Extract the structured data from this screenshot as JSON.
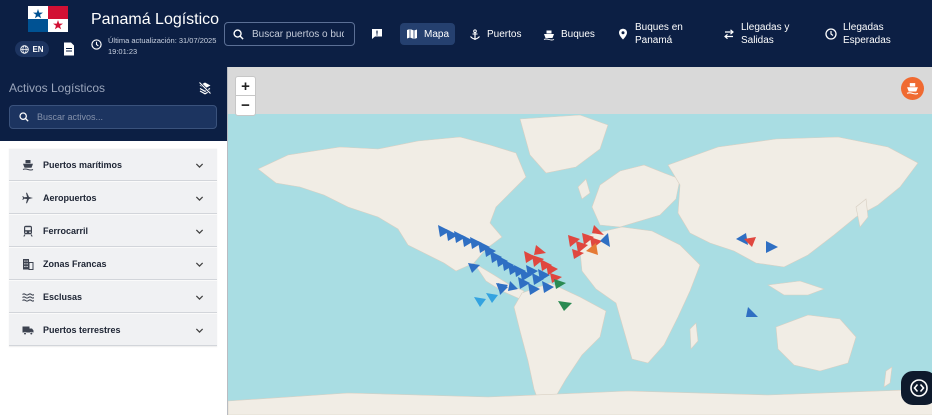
{
  "header": {
    "title": "Panamá Logístico",
    "lang_label": "EN",
    "update_line1": "Última actualización: 31/07/2025",
    "update_line2": "19:01:23",
    "search_placeholder": "Buscar puertos o buques...",
    "nav": {
      "report_icon": "report-icon",
      "map_label": "Mapa",
      "ports_label": "Puertos",
      "ships_label": "Buques",
      "ships_in_panama_l1": "Buques en",
      "ships_in_panama_l2": "Panamá",
      "arrivals_l1": "Llegadas y",
      "arrivals_l2": "Salidas",
      "expected_l1": "Llegadas",
      "expected_l2": "Esperadas"
    }
  },
  "sidebar": {
    "title": "Activos Logísticos",
    "search_placeholder": "Buscar activos...",
    "items": [
      {
        "label": "Puertos marítimos",
        "icon": "ship-icon"
      },
      {
        "label": "Aeropuertos",
        "icon": "airplane-icon"
      },
      {
        "label": "Ferrocarril",
        "icon": "train-icon"
      },
      {
        "label": "Zonas Francas",
        "icon": "building-icon"
      },
      {
        "label": "Esclusas",
        "icon": "waves-icon"
      },
      {
        "label": "Puertos terrestres",
        "icon": "truck-icon"
      }
    ]
  },
  "map": {
    "zoom_in": "+",
    "zoom_out": "−",
    "colors": {
      "ocean": "#a9dde3",
      "land": "#f1ede5",
      "top_bar": "#d9d9d9",
      "ship_blue": "#2f6fc3",
      "ship_red": "#e0473f",
      "ship_green": "#2a8a52",
      "ship_orange": "#e57a35",
      "ship_lightblue": "#34a3e0"
    }
  },
  "colors": {
    "header_bg": "#0c1f44",
    "accent_orange": "#f06a31"
  }
}
